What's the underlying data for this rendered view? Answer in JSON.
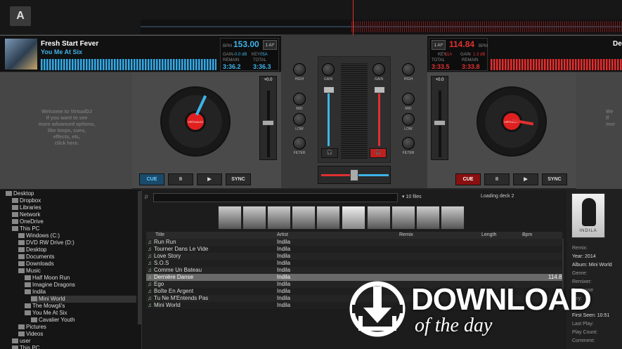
{
  "app": {
    "logo": "A"
  },
  "colors": {
    "accent_blue": "#3fb3e8",
    "accent_red": "#e03030"
  },
  "deckA": {
    "title": "Fresh Start Fever",
    "artist": "You Me At Six",
    "bpm": "153.00",
    "bpm_label": "BPM",
    "gain_label": "GAIN",
    "gain_value": "-0.0 dB",
    "key_label": "KEY",
    "key_value": "05A",
    "remain_label": "REMAIN",
    "remain": "3:36.2",
    "total_label": "TOTAL",
    "total": "3:36.3",
    "auto_label": "1 AI*",
    "welcome": [
      "Welcome to VirtualDJ",
      "If you want to see",
      "more advanced options,",
      "like loops, cues,",
      "effects, etc,",
      "click here."
    ],
    "pitch_value": "+0.0",
    "label_text": "VIRTUALDJ",
    "buttons": {
      "cue": "CUE",
      "pause": "II",
      "play": "▶",
      "sync": "SYNC"
    }
  },
  "deckB": {
    "title": "De",
    "bpm": "114.84",
    "bpm_label": "BPM",
    "gain_label": "GAIN",
    "gain_value": "1.3 dB",
    "key_label": "KEY",
    "key_value": "11A",
    "total_label": "TOTAL",
    "total": "3:33.5",
    "remain_label": "REMAIN",
    "remain": "3:33.8",
    "auto_label": "1 AI*",
    "welcome": [
      "We",
      "If",
      "mor",
      "",
      "",
      ""
    ],
    "pitch_value": "+0.0",
    "label_text": "VIRTUALDJ",
    "buttons": {
      "cue": "CUE",
      "pause": "II",
      "play": "▶",
      "sync": "SYNC"
    }
  },
  "mixer": {
    "high": "HIGH",
    "mid": "MID",
    "low": "LOW",
    "filter": "FILTER",
    "gain": "GAIN"
  },
  "browser": {
    "tree": [
      {
        "label": "Desktop",
        "indent": 0
      },
      {
        "label": "Dropbox",
        "indent": 1
      },
      {
        "label": "Libraries",
        "indent": 1
      },
      {
        "label": "Network",
        "indent": 1
      },
      {
        "label": "OneDrive",
        "indent": 1
      },
      {
        "label": "This PC",
        "indent": 1
      },
      {
        "label": "Windows (C:)",
        "indent": 2
      },
      {
        "label": "DVD RW Drive (D:)",
        "indent": 2
      },
      {
        "label": "Desktop",
        "indent": 2
      },
      {
        "label": "Documents",
        "indent": 2
      },
      {
        "label": "Downloads",
        "indent": 2
      },
      {
        "label": "Music",
        "indent": 2
      },
      {
        "label": "Half Moon Run",
        "indent": 3
      },
      {
        "label": "Imagine Dragons",
        "indent": 3
      },
      {
        "label": "Indila",
        "indent": 3
      },
      {
        "label": "Mini World",
        "indent": 4
      },
      {
        "label": "The Mowgli's",
        "indent": 3
      },
      {
        "label": "You Me At Six",
        "indent": 3
      },
      {
        "label": "Cavalier Youth",
        "indent": 4
      },
      {
        "label": "Pictures",
        "indent": 2
      },
      {
        "label": "Videos",
        "indent": 2
      },
      {
        "label": "user",
        "indent": 1
      },
      {
        "label": "This PC",
        "indent": 1
      }
    ],
    "file_count": "10 files",
    "loading": "Loading deck 2",
    "columns": {
      "title": "Title",
      "artist": "Artist",
      "remix": "Remix",
      "length": "Length",
      "bpm": "Bpm"
    },
    "rows": [
      {
        "title": "Run Run",
        "artist": "Indila",
        "bpm": ""
      },
      {
        "title": "Tourner Dans Le Vide",
        "artist": "Indila",
        "bpm": ""
      },
      {
        "title": "Love Story",
        "artist": "Indila",
        "bpm": ""
      },
      {
        "title": "S.O.S",
        "artist": "Indila",
        "bpm": ""
      },
      {
        "title": "Comme Un Bateau",
        "artist": "Indila",
        "bpm": ""
      },
      {
        "title": "Dernière Danse",
        "artist": "Indila",
        "bpm": "114.8"
      },
      {
        "title": "Ego",
        "artist": "Indila",
        "bpm": ""
      },
      {
        "title": "Boîte En Argent",
        "artist": "Indila",
        "bpm": ""
      },
      {
        "title": "Tu Ne M'Entends Pas",
        "artist": "Indila",
        "bpm": ""
      },
      {
        "title": "Mini World",
        "artist": "Indila",
        "bpm": ""
      }
    ],
    "selected_row": 5
  },
  "info": {
    "remix": "Remix:",
    "year": "Year: 2014",
    "album": "Album: Mini World",
    "genre": "Genre:",
    "remixer": "Remixer:",
    "composer": "Compose",
    "key": "Key:",
    "length": "Length:",
    "first_seen": "First Seen: 10:51",
    "last_play": "Last Play:",
    "play_count": "Play Count:",
    "comment": "Comment:",
    "cover_text": "INDILA"
  },
  "watermark": {
    "line1": "DOWNLOAD",
    "line2": "of the day"
  }
}
